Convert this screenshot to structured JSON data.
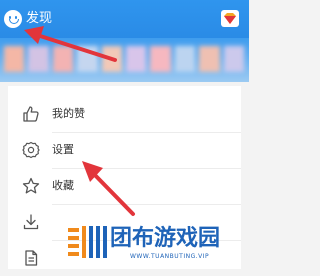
{
  "header": {
    "title": "发现"
  },
  "menu": {
    "items": [
      {
        "label": "我的赞",
        "icon": "thumbs-up-icon"
      },
      {
        "label": "设置",
        "icon": "settings-gear-icon"
      },
      {
        "label": "收藏",
        "icon": "star-icon"
      },
      {
        "label": "",
        "icon": "download-icon"
      },
      {
        "label": "",
        "icon": "document-icon"
      }
    ]
  },
  "watermark": {
    "text": "团布游戏园",
    "url": "WWW.TUANBUTING.VIP"
  },
  "colors": {
    "header": "#2a8be6",
    "arrow": "#e2353b",
    "watermark": "#1e63b8"
  }
}
